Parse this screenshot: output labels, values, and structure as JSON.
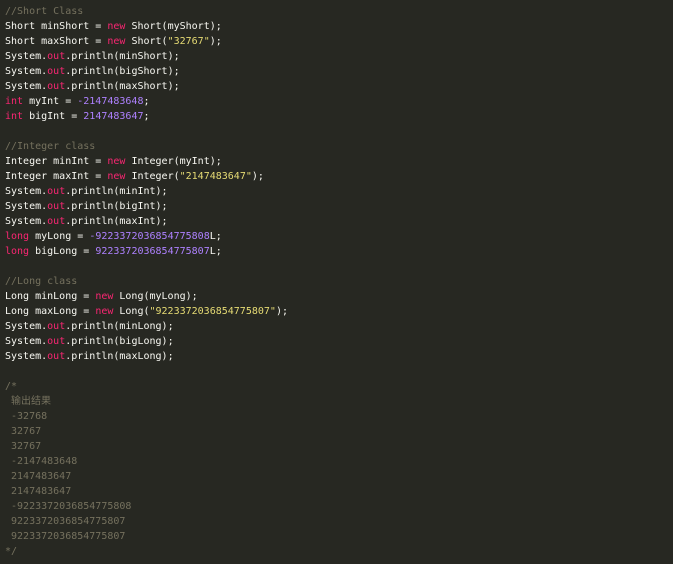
{
  "editor": {
    "lines": [
      [
        {
          "t": "//Short Class",
          "c": "cm"
        }
      ],
      [
        {
          "t": "Short minShort = ",
          "c": "plain"
        },
        {
          "t": "new",
          "c": "kw"
        },
        {
          "t": " Short(myShort);",
          "c": "plain"
        }
      ],
      [
        {
          "t": "Short maxShort = ",
          "c": "plain"
        },
        {
          "t": "new",
          "c": "kw"
        },
        {
          "t": " Short(",
          "c": "plain"
        },
        {
          "t": "\"32767\"",
          "c": "str"
        },
        {
          "t": ");",
          "c": "plain"
        }
      ],
      [
        {
          "t": "System.",
          "c": "plain"
        },
        {
          "t": "out",
          "c": "out"
        },
        {
          "t": ".println(minShort);",
          "c": "plain"
        }
      ],
      [
        {
          "t": "System.",
          "c": "plain"
        },
        {
          "t": "out",
          "c": "out"
        },
        {
          "t": ".println(bigShort);",
          "c": "plain"
        }
      ],
      [
        {
          "t": "System.",
          "c": "plain"
        },
        {
          "t": "out",
          "c": "out"
        },
        {
          "t": ".println(maxShort);",
          "c": "plain"
        }
      ],
      [
        {
          "t": "int",
          "c": "kw"
        },
        {
          "t": " myInt = ",
          "c": "plain"
        },
        {
          "t": "-2147483648",
          "c": "num"
        },
        {
          "t": ";",
          "c": "plain"
        }
      ],
      [
        {
          "t": "int",
          "c": "kw"
        },
        {
          "t": " bigInt = ",
          "c": "plain"
        },
        {
          "t": "2147483647",
          "c": "num"
        },
        {
          "t": ";",
          "c": "plain"
        }
      ],
      [
        {
          "t": "",
          "c": "plain"
        }
      ],
      [
        {
          "t": "//Integer class",
          "c": "cm"
        }
      ],
      [
        {
          "t": "Integer minInt = ",
          "c": "plain"
        },
        {
          "t": "new",
          "c": "kw"
        },
        {
          "t": " Integer(myInt);",
          "c": "plain"
        }
      ],
      [
        {
          "t": "Integer maxInt = ",
          "c": "plain"
        },
        {
          "t": "new",
          "c": "kw"
        },
        {
          "t": " Integer(",
          "c": "plain"
        },
        {
          "t": "\"2147483647\"",
          "c": "str"
        },
        {
          "t": ");",
          "c": "plain"
        }
      ],
      [
        {
          "t": "System.",
          "c": "plain"
        },
        {
          "t": "out",
          "c": "out"
        },
        {
          "t": ".println(minInt);",
          "c": "plain"
        }
      ],
      [
        {
          "t": "System.",
          "c": "plain"
        },
        {
          "t": "out",
          "c": "out"
        },
        {
          "t": ".println(bigInt);",
          "c": "plain"
        }
      ],
      [
        {
          "t": "System.",
          "c": "plain"
        },
        {
          "t": "out",
          "c": "out"
        },
        {
          "t": ".println(maxInt);",
          "c": "plain"
        }
      ],
      [
        {
          "t": "long",
          "c": "kw"
        },
        {
          "t": " myLong = ",
          "c": "plain"
        },
        {
          "t": "-9223372036854775808",
          "c": "num"
        },
        {
          "t": "L;",
          "c": "plain"
        }
      ],
      [
        {
          "t": "long",
          "c": "kw"
        },
        {
          "t": " bigLong = ",
          "c": "plain"
        },
        {
          "t": "9223372036854775807",
          "c": "num"
        },
        {
          "t": "L;",
          "c": "plain"
        }
      ],
      [
        {
          "t": "",
          "c": "plain"
        }
      ],
      [
        {
          "t": "//Long class",
          "c": "cm"
        }
      ],
      [
        {
          "t": "Long minLong = ",
          "c": "plain"
        },
        {
          "t": "new",
          "c": "kw"
        },
        {
          "t": " Long(myLong);",
          "c": "plain"
        }
      ],
      [
        {
          "t": "Long maxLong = ",
          "c": "plain"
        },
        {
          "t": "new",
          "c": "kw"
        },
        {
          "t": " Long(",
          "c": "plain"
        },
        {
          "t": "\"9223372036854775807\"",
          "c": "str"
        },
        {
          "t": ");",
          "c": "plain"
        }
      ],
      [
        {
          "t": "System.",
          "c": "plain"
        },
        {
          "t": "out",
          "c": "out"
        },
        {
          "t": ".println(minLong);",
          "c": "plain"
        }
      ],
      [
        {
          "t": "System.",
          "c": "plain"
        },
        {
          "t": "out",
          "c": "out"
        },
        {
          "t": ".println(bigLong);",
          "c": "plain"
        }
      ],
      [
        {
          "t": "System.",
          "c": "plain"
        },
        {
          "t": "out",
          "c": "out"
        },
        {
          "t": ".println(maxLong);",
          "c": "plain"
        }
      ],
      [
        {
          "t": "",
          "c": "plain"
        }
      ],
      [
        {
          "t": "/*",
          "c": "cm"
        }
      ],
      [
        {
          "t": " 输出结果",
          "c": "cm"
        }
      ],
      [
        {
          "t": " -32768",
          "c": "cm"
        }
      ],
      [
        {
          "t": " 32767",
          "c": "cm"
        }
      ],
      [
        {
          "t": " 32767",
          "c": "cm"
        }
      ],
      [
        {
          "t": " -2147483648",
          "c": "cm"
        }
      ],
      [
        {
          "t": " 2147483647",
          "c": "cm"
        }
      ],
      [
        {
          "t": " 2147483647",
          "c": "cm"
        }
      ],
      [
        {
          "t": " -9223372036854775808",
          "c": "cm"
        }
      ],
      [
        {
          "t": " 9223372036854775807",
          "c": "cm"
        }
      ],
      [
        {
          "t": " 9223372036854775807",
          "c": "cm"
        }
      ],
      [
        {
          "t": "*/",
          "c": "cm"
        }
      ]
    ]
  },
  "colors": {
    "background": "#272822",
    "comment": "#75715e",
    "keyword": "#f92672",
    "number": "#ae81ff",
    "string": "#e6db74",
    "text": "#f8f8f2"
  }
}
